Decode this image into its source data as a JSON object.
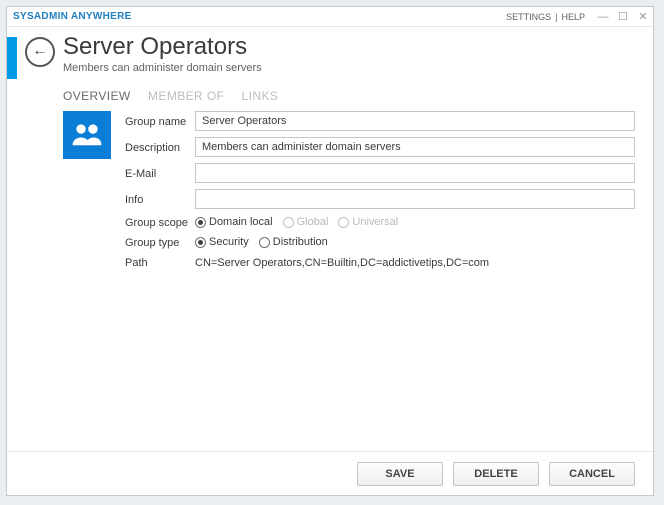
{
  "brand": "SYSADMIN ANYWHERE",
  "toplinks": {
    "settings": "SETTINGS",
    "sep": "|",
    "help": "HELP"
  },
  "header": {
    "title": "Server Operators",
    "subtitle": "Members can administer domain servers"
  },
  "tabs": {
    "overview": "OVERVIEW",
    "memberof": "MEMBER OF",
    "links": "LINKS"
  },
  "form": {
    "group_name": {
      "label": "Group name",
      "value": "Server Operators"
    },
    "description": {
      "label": "Description",
      "value": "Members can administer domain servers"
    },
    "email": {
      "label": "E-Mail",
      "value": ""
    },
    "info": {
      "label": "Info",
      "value": ""
    },
    "group_scope": {
      "label": "Group scope",
      "options": {
        "domain_local": "Domain local",
        "global": "Global",
        "universal": "Universal"
      },
      "selected": "domain_local",
      "disabled": [
        "global",
        "universal"
      ]
    },
    "group_type": {
      "label": "Group type",
      "options": {
        "security": "Security",
        "distribution": "Distribution"
      },
      "selected": "security"
    },
    "path": {
      "label": "Path",
      "value": "CN=Server Operators,CN=Builtin,DC=addictivetips,DC=com"
    }
  },
  "buttons": {
    "save": "SAVE",
    "delete": "DELETE",
    "cancel": "CANCEL"
  }
}
